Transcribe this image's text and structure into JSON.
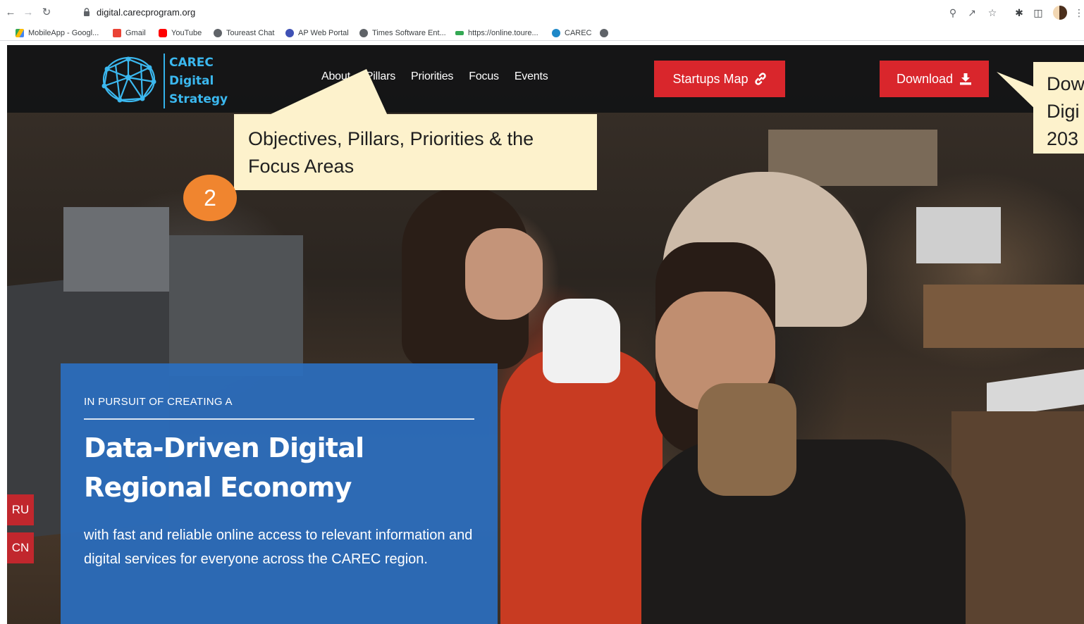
{
  "browser": {
    "url": "digital.carecprogram.org",
    "bookmarks": [
      {
        "label": "MobileApp - Googl...",
        "color": "#4285f4"
      },
      {
        "label": "Gmail",
        "color": "#ea4335"
      },
      {
        "label": "YouTube",
        "color": "#ff0000"
      },
      {
        "label": "Toureast Chat",
        "color": "#5f6368"
      },
      {
        "label": "AP Web Portal",
        "color": "#3f51b5"
      },
      {
        "label": "Times Software Ent...",
        "color": "#5f6368"
      },
      {
        "label": "https://online.toure...",
        "color": "#34a853"
      },
      {
        "label": "CAREC",
        "color": "#1e88c8"
      }
    ]
  },
  "site": {
    "logo_lines": [
      "CAREC",
      "Digital",
      "Strategy"
    ],
    "nav": [
      "About",
      "Pillars",
      "Priorities",
      "Focus",
      "Events"
    ],
    "startups_button": "Startups Map",
    "download_button": "Download"
  },
  "annotations": {
    "step_number": "2",
    "focus_note": "Objectives, Pillars, Priorities & the Focus Areas",
    "download_note_lines": [
      "Dow",
      "Digi",
      "203"
    ]
  },
  "hero": {
    "kicker": "IN PURSUIT OF CREATING A",
    "headline_lines": [
      "Data-Driven Digital",
      "Regional Economy"
    ],
    "body": "with fast and reliable online access to relevant information and digital services for everyone across the CAREC region."
  },
  "languages": [
    "RU",
    "CN"
  ],
  "colors": {
    "accent_red": "#d9262c",
    "hero_blue": "#2b6ebe",
    "logo_blue": "#3bb8ef",
    "note_bg": "#fdf2cc",
    "badge_orange": "#f0852f"
  }
}
